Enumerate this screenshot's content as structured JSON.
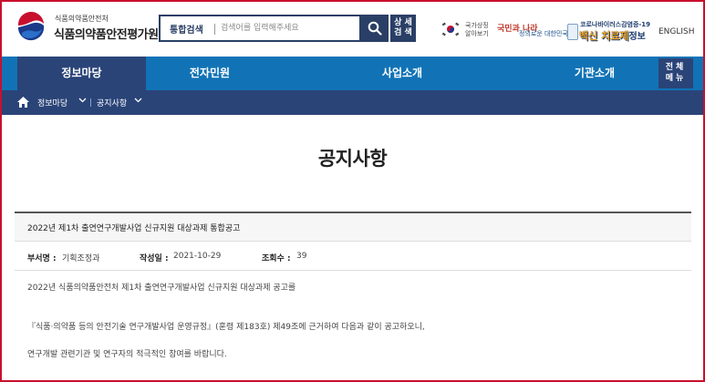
{
  "header": {
    "org_small": "식품의약품안전처",
    "org_name": "식품의약품안전평가원",
    "search": {
      "category": "통합검색",
      "placeholder": "검색어를 입력해주세요",
      "detail_label_1": "상 세",
      "detail_label_2": "검 색"
    },
    "nation_line1": "국가상징",
    "nation_line2": "알아보기",
    "slogan_1": "국민과 나라",
    "slogan_2": "정의로운 대한민국",
    "covid_line1": "코로나바이러스감염증-19",
    "covid_line2": "백신 치료제",
    "covid_line2_suffix": "정보",
    "english": "ENGLISH"
  },
  "nav": {
    "items": [
      {
        "label": "정보마당"
      },
      {
        "label": "전자민원"
      },
      {
        "label": "사업소개"
      },
      {
        "label": "기관소개"
      }
    ],
    "menu_line1": "전체",
    "menu_line2": "메뉴"
  },
  "breadcrumb": {
    "level1": "정보마당",
    "level2": "공지사항"
  },
  "page_title": "공지사항",
  "post": {
    "title": "2022년 제1차 출연연구개발사업 신규지원 대상과제 통합공고",
    "dept_label": "부서명 :",
    "dept_value": "기획조정과",
    "date_label": "작성일 :",
    "date_value": "2021-10-29",
    "views_label": "조회수 :",
    "views_value": "39",
    "body": [
      "2022년 식품의약품안전처 제1차 출연연구개발사업 신규지원 대상과제 공고를",
      "『식품·의약품 등의 안전기술 연구개발사업 운영규정』(훈령 제183호) 제49조에 근거하여 다음과 같이 공고하오니,",
      "연구개발 관련기관 및 연구자의 적극적인 참여를 바랍니다."
    ]
  },
  "colors": {
    "nav_blue": "#1173b6",
    "nav_dark": "#2a4478",
    "frame_red": "#c8102e"
  }
}
